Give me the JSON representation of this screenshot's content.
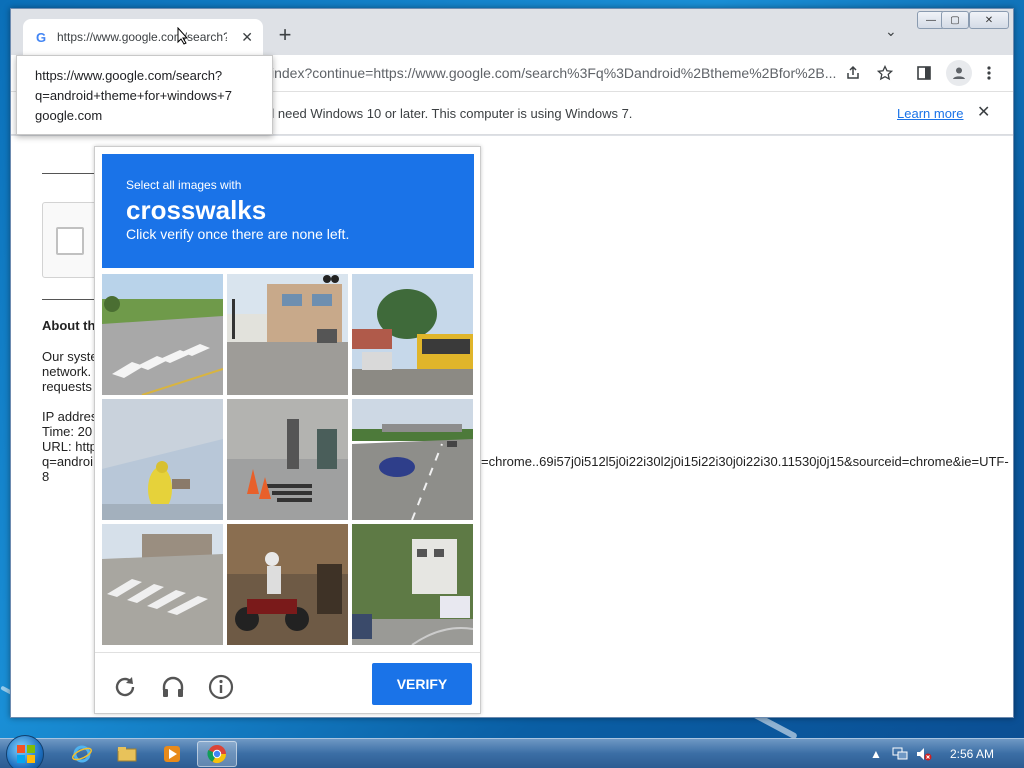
{
  "browser": {
    "tab": {
      "title": "https://www.google.com/search?q=android+theme+for+windows+7",
      "favicon": "G",
      "close": "✕"
    },
    "new_tab": "+",
    "tab_menu": "⌄",
    "window_controls": {
      "minimize": "—",
      "maximize": "▢",
      "close": "✕"
    },
    "address": "index?continue=https://www.google.com/search%3Fq%3Dandroid%2Btheme%2Bfor%2B...",
    "toolbar_icons": [
      "share-icon",
      "star-icon",
      "sidepanel-icon",
      "profile-icon",
      "menu-icon"
    ]
  },
  "tooltip": {
    "line1": "https://www.google.com/search?",
    "line2": "q=android+theme+for+windows+7",
    "line3": "google.com"
  },
  "infobar": {
    "text": "'ll need Windows 10 or later. This computer is using Windows 7.",
    "link": "Learn more",
    "close": "✕"
  },
  "page": {
    "about_heading": "About th",
    "para1": "Our syste",
    "para2": "network.",
    "para3": "requests",
    "ip": "IP addres",
    "time": "Time: 20",
    "url": "URL: http",
    "q": "q=androi",
    "url_tail": "=chrome..69i57j0i512l5j0i22i30l2j0i15i22i30j0i22i30.11530j0j15&sourceid=chrome&ie=UTF-",
    "eight": "8"
  },
  "captcha": {
    "instruction": "Select all images with",
    "target": "crosswalks",
    "subinstruction": "Click verify once there are none left.",
    "verify_label": "VERIFY",
    "footer_icons": [
      "reload-icon",
      "audio-icon",
      "info-icon"
    ]
  },
  "taskbar": {
    "clock": "2:56 AM",
    "apps": [
      "internet-explorer-icon",
      "explorer-icon",
      "media-player-icon",
      "chrome-icon"
    ]
  },
  "colors": {
    "captcha_blue": "#1a73e8",
    "link_blue": "#1a73e8"
  }
}
